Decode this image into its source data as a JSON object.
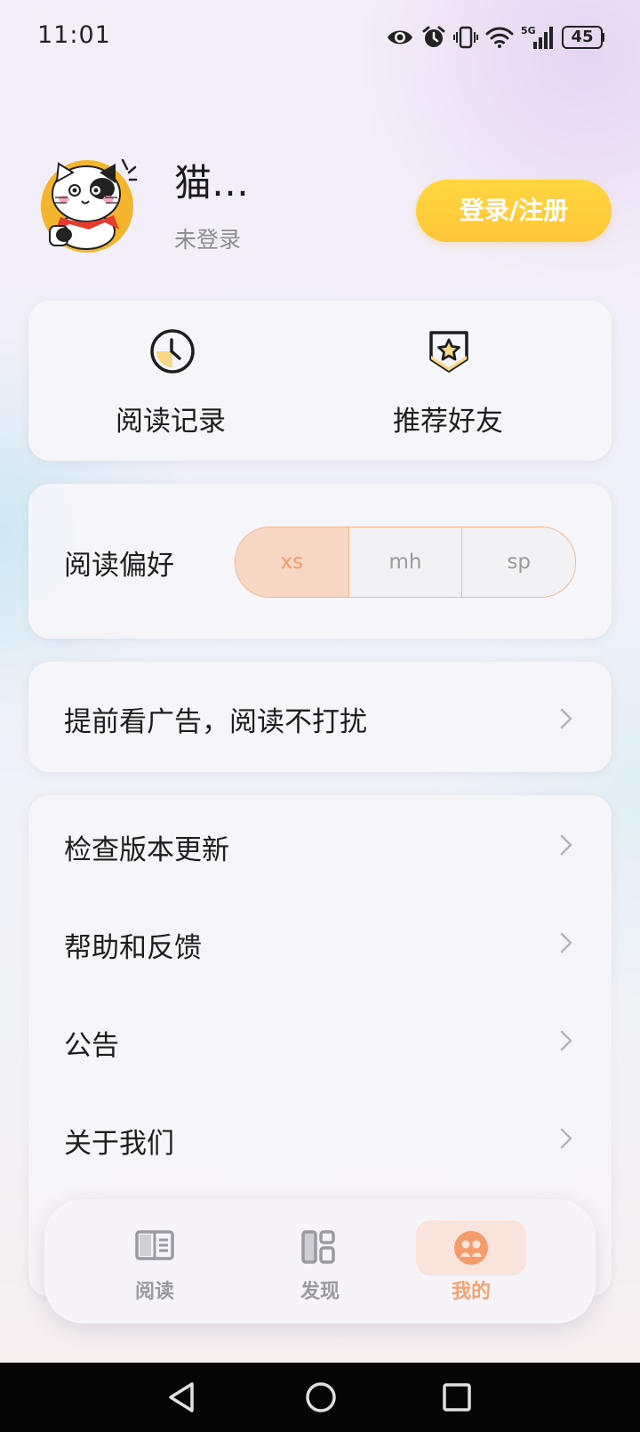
{
  "status_bar": {
    "time": "11:01",
    "icons": [
      "eye-icon",
      "alarm-icon",
      "vibrate-icon",
      "wifi-icon",
      "5g-signal-icon",
      "battery-icon"
    ],
    "network_label": "5G",
    "battery_level": "45"
  },
  "profile": {
    "avatar": "lucky-cat-avatar",
    "name": "猫…",
    "login_status": "未登录",
    "login_button": "登录/注册"
  },
  "quick_actions": [
    {
      "label": "阅读记录",
      "icon": "clock-icon"
    },
    {
      "label": "推荐好友",
      "icon": "star-badge-icon"
    }
  ],
  "reading_preference": {
    "label": "阅读偏好",
    "options": [
      "xs",
      "mh",
      "sp"
    ],
    "selected": "xs"
  },
  "ad_row": {
    "label": "提前看广告，阅读不打扰"
  },
  "menu": {
    "items": [
      {
        "label": "检查版本更新"
      },
      {
        "label": "帮助和反馈"
      },
      {
        "label": "公告"
      },
      {
        "label": "关于我们"
      }
    ]
  },
  "bottom_nav": {
    "tabs": [
      {
        "label": "阅读",
        "icon": "book-icon"
      },
      {
        "label": "发现",
        "icon": "discover-grid-icon"
      },
      {
        "label": "我的",
        "icon": "profile-icon"
      }
    ],
    "active": "我的"
  },
  "colors": {
    "accent_yellow": "#ffc93c",
    "accent_orange": "#f6a26f",
    "selected_bg": "#f8d6c4"
  }
}
